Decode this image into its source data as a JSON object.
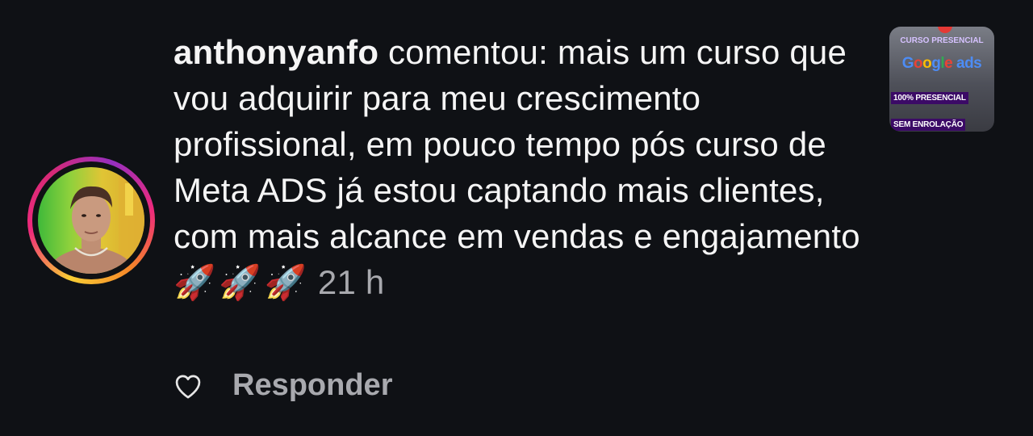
{
  "comment": {
    "username": "anthonyanfo",
    "text": " comentou: mais um curso que vou adquirir para meu crescimento profissional, em pouco tempo pós curso de Meta ADS já estou captando mais clientes, com mais alcance em vendas e engajamento",
    "emojis": "🚀🚀🚀",
    "time": "21 h"
  },
  "actions": {
    "like_icon": "heart-outline-icon",
    "reply_label": "Responder"
  },
  "post_thumbnail": {
    "top_text": "CURSO PRESENCIAL",
    "brand_word": "Google",
    "brand_suffix": "ads",
    "badge_1": "100% PRESENCIAL",
    "badge_2": "SEM ENROLAÇÃO"
  },
  "colors": {
    "background": "#0f1115",
    "text": "#f5f5f5",
    "muted": "#a8a9ae",
    "badge": "#3b0a66"
  }
}
